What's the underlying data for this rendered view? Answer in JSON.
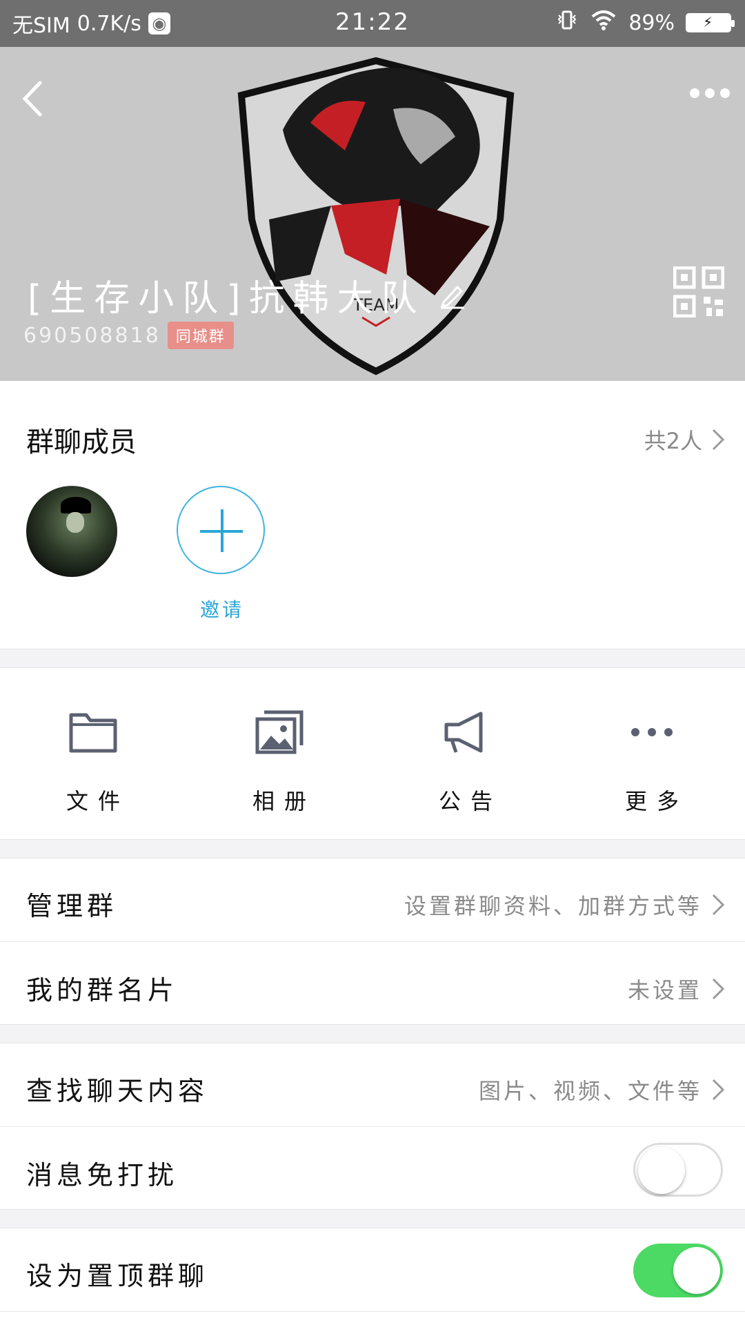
{
  "status_bar": {
    "carrier": "无SIM",
    "speed": "0.7K/s",
    "time": "21:22",
    "battery": "89%"
  },
  "header": {
    "group_name": "[生存小队]抗韩大队",
    "group_id": "690508818",
    "tag": "同城群",
    "logo_text": "TEAM"
  },
  "members": {
    "title": "群聊成员",
    "count": "共2人",
    "invite_label": "邀请"
  },
  "shortcuts": [
    {
      "label": "文件",
      "icon": "folder-icon"
    },
    {
      "label": "相册",
      "icon": "album-icon"
    },
    {
      "label": "公告",
      "icon": "megaphone-icon"
    },
    {
      "label": "更多",
      "icon": "more-dots-icon"
    }
  ],
  "rows": {
    "manage": {
      "title": "管理群",
      "value": "设置群聊资料、加群方式等"
    },
    "my_card": {
      "title": "我的群名片",
      "value": "未设置"
    },
    "search": {
      "title": "查找聊天内容",
      "value": "图片、视频、文件等"
    },
    "mute": {
      "title": "消息免打扰",
      "state": "off"
    },
    "pin": {
      "title": "设为置顶群聊",
      "state": "on"
    }
  },
  "colors": {
    "status_bar": "#6f6f6f",
    "header_bg": "#c8c8c8",
    "accent_blue": "#2aa6d6",
    "toggle_on": "#4cd964",
    "tag_bg": "#e88f8a"
  }
}
